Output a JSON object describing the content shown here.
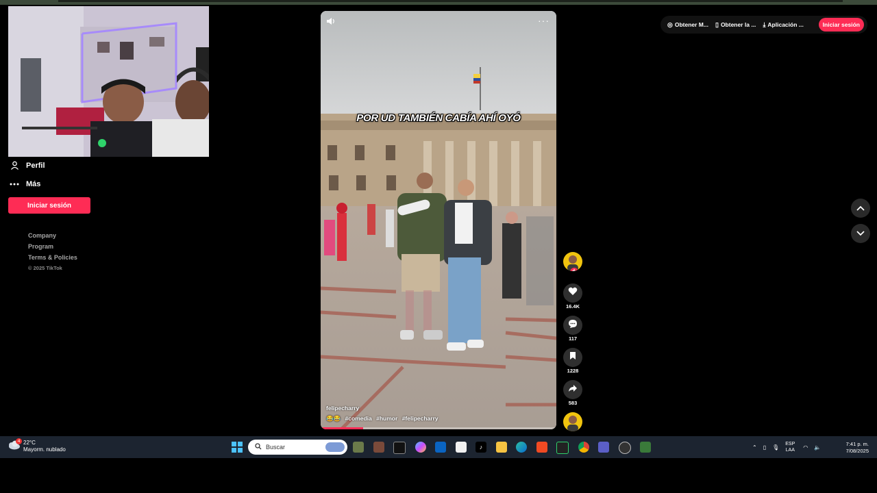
{
  "sidebar": {
    "items": [
      {
        "label": "Perfil",
        "icon": "person-icon"
      },
      {
        "label": "Más",
        "icon": "more-dots-icon"
      }
    ],
    "login_label": "Iniciar sesión",
    "footer": {
      "links": [
        "Company",
        "Program",
        "Terms & Policies"
      ],
      "copyright": "© 2025 TikTok"
    }
  },
  "video": {
    "caption": "POR UD TAMBIÉN CABÍA AHÍ OYÓ",
    "author": "felipecharry",
    "emoji": "😂😂",
    "hashtags": [
      "#comedia",
      "#humor",
      "#felipecharry"
    ],
    "menu_glyph": "···",
    "progress": 0.18
  },
  "actions": {
    "like_count": "16.4K",
    "comment_count": "117",
    "save_count": "1228",
    "share_count": "583"
  },
  "topbar": {
    "items": [
      "Obtener M...",
      "Obtener la ...",
      "Aplicación ..."
    ],
    "signin": "Iniciar sesión"
  },
  "taskbar": {
    "temperature": "22°C",
    "weather_desc": "Mayorm. nublado",
    "weather_badge": "4",
    "search_placeholder": "Buscar",
    "lang_top": "ESP",
    "lang_bottom": "LAA",
    "time": "7:41 p. m.",
    "date": "7/08/2025"
  },
  "colors": {
    "accent": "#fe2c55",
    "taskbar": "#1c2430",
    "start": "#4cc2ff"
  }
}
